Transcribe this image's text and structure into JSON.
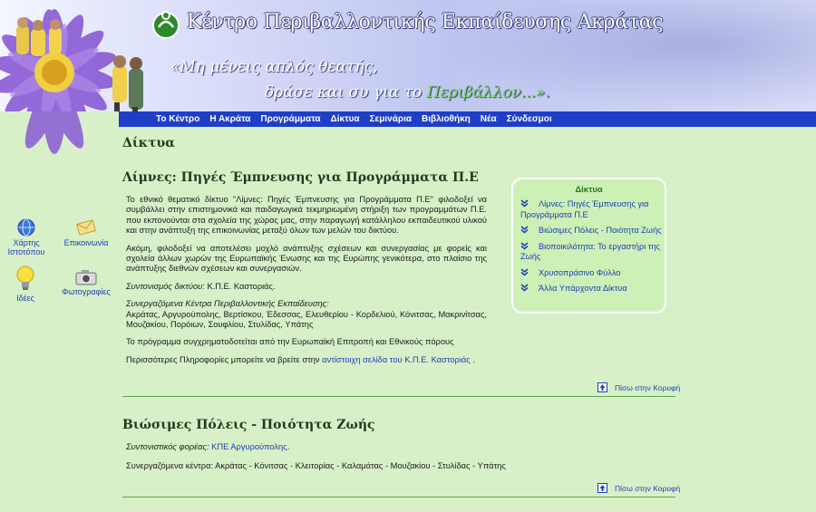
{
  "header": {
    "site_title": "Κέντρο Περιβαλλοντικής Εκπαίδευσης Ακράτας",
    "slogan_line1": "«Μη μένεις απλός θεατής,",
    "slogan_line2_prefix": "δράσε και συ για το ",
    "slogan_line2_green": "Περιβάλλον...».",
    "colors": {
      "nav_bg": "#1f3ec8",
      "accent_green": "#2a7a1a",
      "link_blue": "#1c3fb0",
      "page_bg": "#d8f0c8"
    }
  },
  "nav": {
    "items": [
      "Το Κέντρο",
      "Η Ακράτα",
      "Προγράμματα",
      "Δίκτυα",
      "Σεμινάρια",
      "Βιβλιοθήκη",
      "Νέα",
      "Σύνδεσμοι"
    ]
  },
  "sidebar": {
    "items": [
      {
        "label_line1": "Χάρτης",
        "label_line2": "Ιστοτόπου",
        "icon": "globe-icon"
      },
      {
        "label_line1": "Επικοινωνία",
        "label_line2": "",
        "icon": "envelope-icon"
      },
      {
        "label_line1": "Ιδέες",
        "label_line2": "",
        "icon": "lightbulb-icon"
      },
      {
        "label_line1": "Φωτογραφίες",
        "label_line2": "",
        "icon": "camera-icon"
      }
    ]
  },
  "main": {
    "page_title": "Δίκτυα",
    "section1": {
      "title": "Λίμνες: Πηγές Έμπνευσης για Προγράμματα Π.Ε",
      "p1": "Το εθνικό θεματικό δίκτυο \"Λίμνες: Πηγές Έμπνευσης για Προγράμματα Π.Ε\" φιλοδοξεί να συμβάλλει στην επιστημονικά και παιδαγωγικά τεκμηριωμένη στήριξη των προγραμμάτων Π.Ε. που εκπονούνται στα σχολεία της χώρας μας, στην παραγωγή κατάλληλου εκπαιδευτικού υλικού και στην ανάπτυξη της επικοινωνίας μεταξύ όλων των μελών του δικτύου.",
      "p2": "Ακόμη, φιλοδοξεί να αποτελέσει μοχλό ανάπτυξης σχέσεων και συνεργασίας με φορείς και σχολεία άλλων χωρών της Ευρωπαϊκής Ένωσης και της Ευρώπης γενικότερα, στο πλαίσιο της ανάπτυξης διεθνών σχέσεων και συνεργασιών.",
      "coord_label": "Συντονισμός δικτύου:",
      "coord_value": " Κ.Π.Ε. Καστοριάς.",
      "partners_label": "Συνεργαζόμενα Κέντρα Περιβαλλοντικής Εκπαίδευσης:",
      "partners_value": "Ακράτας, Αργυρούπολης, Βερτίσκου, Έδεσσας, Ελευθερίου - Κορδελιού, Κόνιτσας, Μακρινίτσας, Μουζακίου, Πορόιων, Σουφλίου, Στυλίδας, Υπάτης",
      "funding": "Το πρόγραμμα συγχρηματοδοτείται από την Ευρωπαϊκή Επιτροπή και Εθνικούς πόρους",
      "more_prefix": "Περισσότερες Πληροφορίες μπορείτε να βρείτε στην ",
      "more_link": "αντίστοιχη σελίδα του Κ.Π.Ε. Καστοριάς",
      "more_suffix": " ."
    },
    "section2": {
      "title": "Βιώσιμες Πόλεις - Ποιότητα Ζωής",
      "coord_label": "Συντονιστικός φορέας:",
      "coord_link": "ΚΠΕ Αργυρούπολης",
      "coord_suffix": ".",
      "partners": "Συνεργαζόμενα κέντρα: Ακράτας - Κόνιτσας - Κλειτορίας - Καλαμάτας - Μουζακίου - Στυλίδας - Υπάτης"
    },
    "back_to_top": "Πίσω στην Κορυφή"
  },
  "networks_box": {
    "title": "Δίκτυα",
    "items": [
      "Λίμνες: Πηγές Έμπνευσης για Προγράμματα Π.Ε",
      "Βιώσιμες Πόλεις - Ποιότητα Ζωής",
      "Βιοποικιλότητα: Το εργαστήρι της Ζωής",
      "Χρυσοπράσινο Φύλλο",
      "Άλλα Υπάρχοντα Δίκτυα"
    ]
  }
}
